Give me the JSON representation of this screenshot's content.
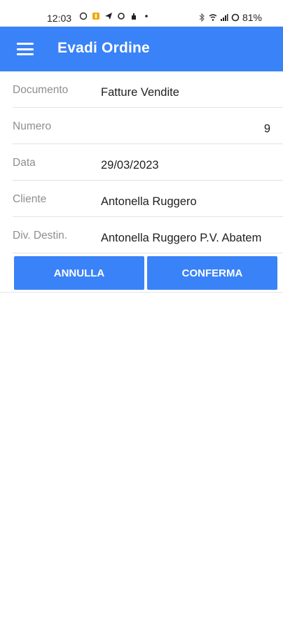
{
  "status_bar": {
    "time": "12:03",
    "battery": "81%"
  },
  "app_bar": {
    "title": "Evadi Ordine"
  },
  "form": {
    "rows": [
      {
        "label": "Documento",
        "value": "Fatture Vendite"
      },
      {
        "label": "Numero",
        "value": "9"
      },
      {
        "label": "Data",
        "value": "29/03/2023"
      },
      {
        "label": "Cliente",
        "value": "Antonella Ruggero"
      },
      {
        "label": "Div. Destin.",
        "value": "Antonella Ruggero P.V. Abatem"
      }
    ]
  },
  "actions": {
    "cancel_label": "ANNULLA",
    "confirm_label": "CONFERMA"
  },
  "colors": {
    "accent": "#3a82f7"
  }
}
